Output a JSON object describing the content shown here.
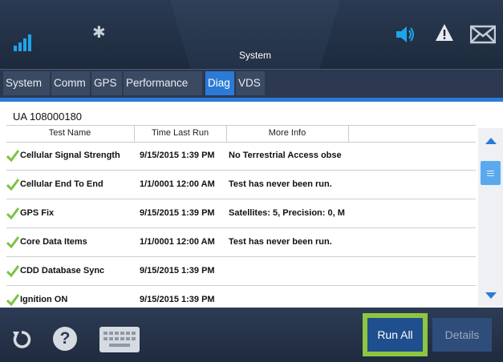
{
  "status_bar": {
    "title": "System",
    "bluetooth_glyph": "✱"
  },
  "tabs": [
    {
      "label": "System",
      "active": false
    },
    {
      "label": "Comm",
      "active": false
    },
    {
      "label": "GPS",
      "active": false
    },
    {
      "label": "Performance",
      "active": false
    },
    {
      "label": "Diag",
      "active": true
    },
    {
      "label": "VDS",
      "active": false
    }
  ],
  "unit_id": "UA 108000180",
  "table": {
    "columns": [
      "Test Name",
      "Time Last Run",
      "More Info"
    ],
    "rows": [
      {
        "name": "Cellular Signal Strength",
        "time": "9/15/2015 1:39 PM",
        "info": "No Terrestrial Access obse",
        "status": "pass"
      },
      {
        "name": "Cellular End To End",
        "time": "1/1/0001 12:00 AM",
        "info": "Test has never been run.",
        "status": "pass"
      },
      {
        "name": "GPS Fix",
        "time": "9/15/2015 1:39 PM",
        "info": "Satellites: 5, Precision: 0, M",
        "status": "pass"
      },
      {
        "name": "Core Data Items",
        "time": "1/1/0001 12:00 AM",
        "info": "Test has never been run.",
        "status": "pass"
      },
      {
        "name": "CDD Database Sync",
        "time": "9/15/2015 1:39 PM",
        "info": "",
        "status": "pass"
      },
      {
        "name": "Ignition ON",
        "time": "9/15/2015 1:39 PM",
        "info": "",
        "status": "pass"
      }
    ]
  },
  "bottom": {
    "help_glyph": "?",
    "run_all_label": "Run All",
    "details_label": "Details"
  },
  "colors": {
    "accent": "#2b7bd6",
    "check": "#7cc242",
    "run_all_highlight": "#8dc63f"
  },
  "icons": [
    "signal-icon",
    "bluetooth-icon",
    "speaker-icon",
    "warning-icon",
    "mail-icon",
    "refresh-icon",
    "help-icon",
    "keyboard-icon",
    "check-icon"
  ]
}
